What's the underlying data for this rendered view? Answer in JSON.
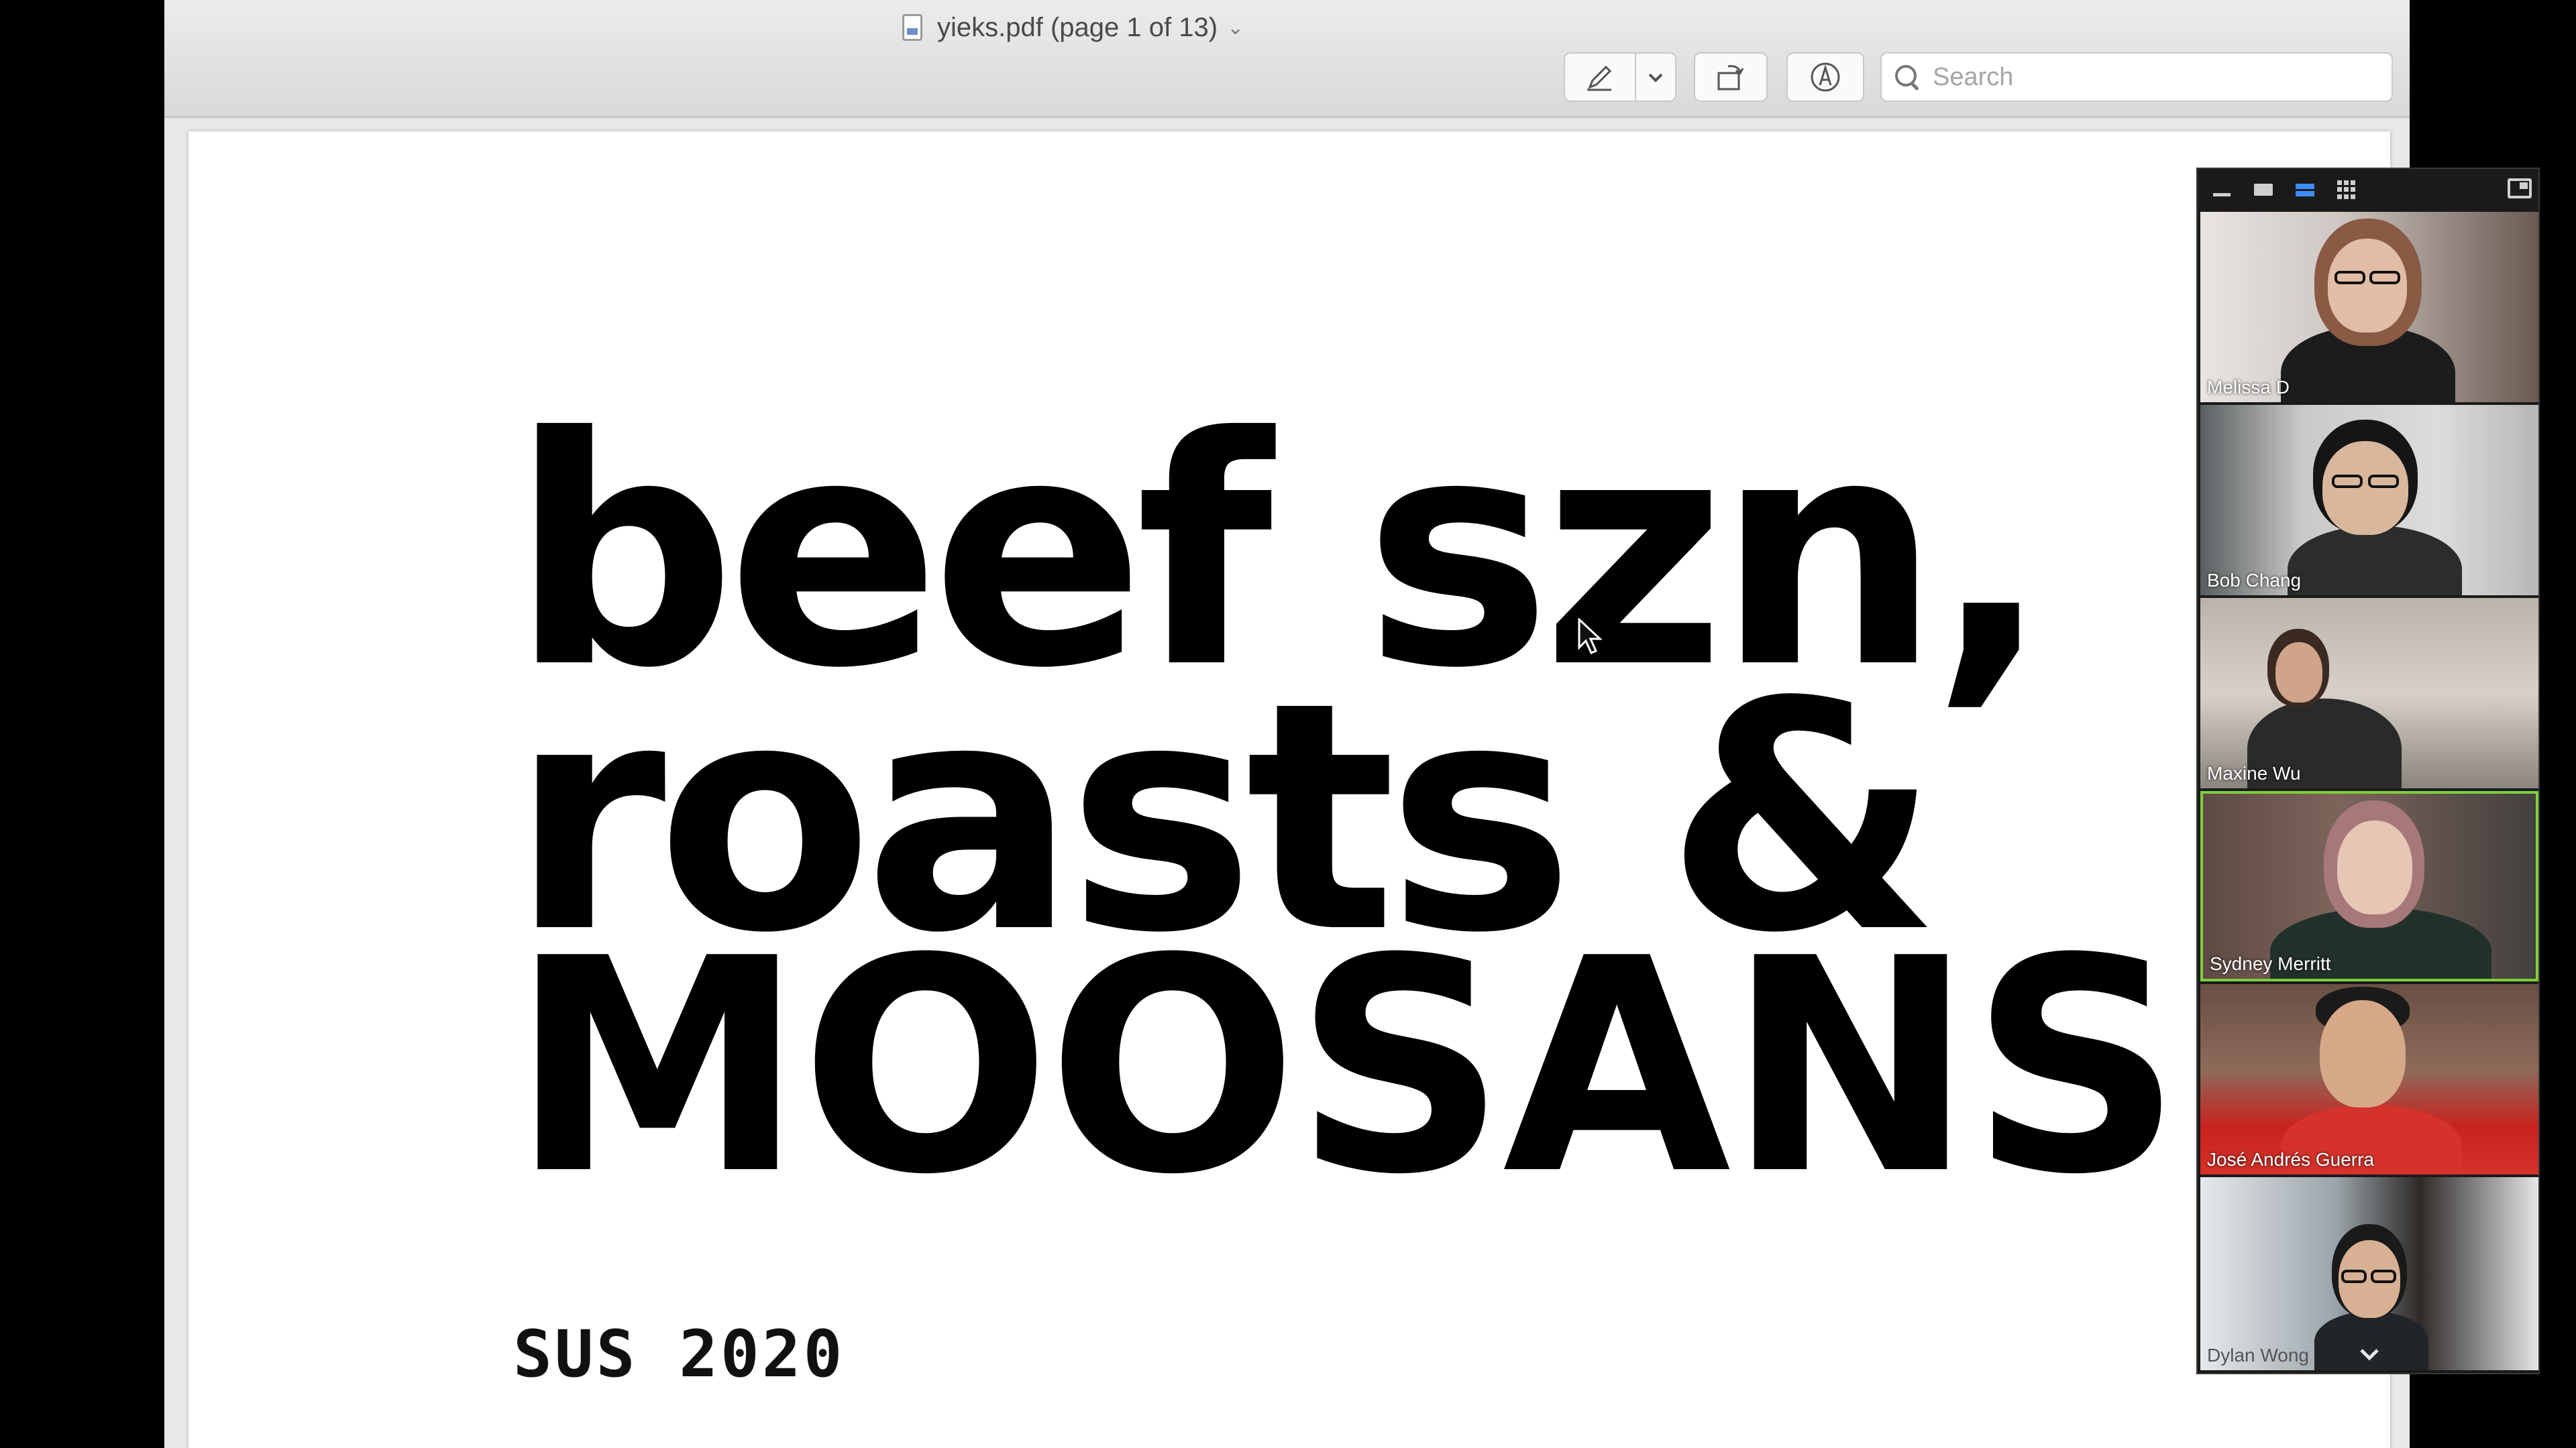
{
  "window": {
    "title": "yieks.pdf (page 1 of 13)",
    "title_chevron": "⌄"
  },
  "toolbar": {
    "markup_icon": "pen-icon",
    "rotate_icon": "rotate-icon",
    "annotate_icon": "markup-circle-icon",
    "search_placeholder": "Search"
  },
  "page": {
    "line1": "beef szn,",
    "line2": "roasts &",
    "line3": "MOOSANS.",
    "subtitle": "SUS 2020"
  },
  "gallery": {
    "participants": [
      {
        "name": "Melissa D"
      },
      {
        "name": "Bob Chang"
      },
      {
        "name": "Maxine Wu"
      },
      {
        "name": "Sydney Merritt",
        "active": true
      },
      {
        "name": "José Andrés Guerra"
      },
      {
        "name": "Dylan Wong"
      }
    ],
    "active_color": "#7ccf3a",
    "view_accent": "#3d8bff"
  }
}
